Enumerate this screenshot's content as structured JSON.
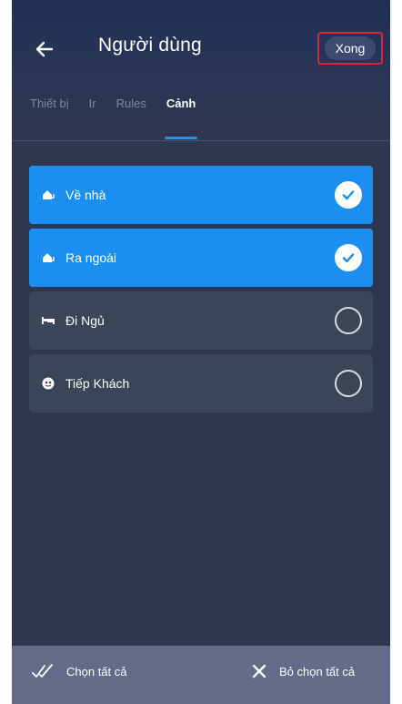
{
  "header": {
    "title": "Người dùng",
    "done_label": "Xong"
  },
  "tabs": [
    {
      "label": "Thiết bị",
      "active": false
    },
    {
      "label": "Ir",
      "active": false
    },
    {
      "label": "Rules",
      "active": false
    },
    {
      "label": "Cảnh",
      "active": true
    }
  ],
  "scenes": [
    {
      "label": "Về nhà",
      "icon": "home-arrow-icon",
      "selected": true
    },
    {
      "label": "Ra ngoài",
      "icon": "home-arrow-icon",
      "selected": true
    },
    {
      "label": "Đi Ngủ",
      "icon": "bed-icon",
      "selected": false
    },
    {
      "label": "Tiếp Khách",
      "icon": "guest-icon",
      "selected": false
    }
  ],
  "bottom": {
    "select_all": "Chọn tất cả",
    "deselect_all": "Bỏ chọn tất cả"
  },
  "colors": {
    "accent": "#1b8ef2",
    "background": "#2f3650",
    "highlight_border": "#d9263a"
  }
}
